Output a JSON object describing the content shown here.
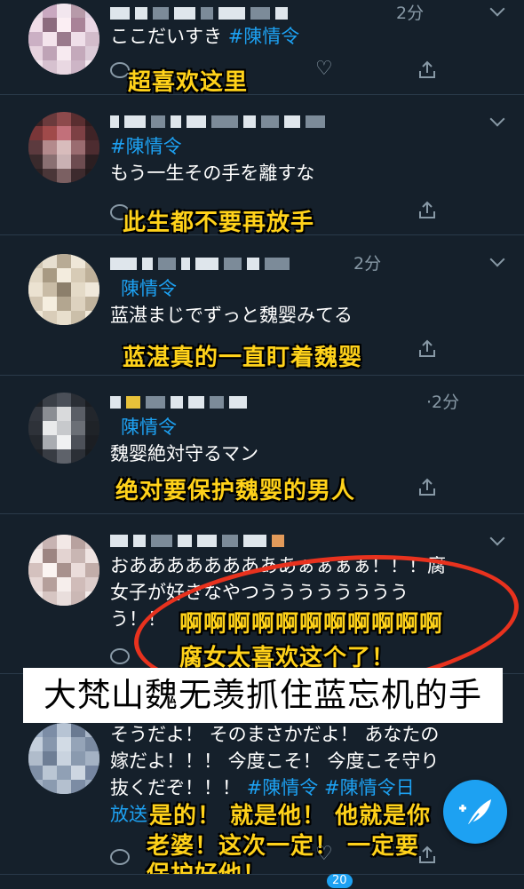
{
  "tweets": [
    {
      "time": "2分",
      "text_parts": [
        "ここだいすき ",
        "#陳情令"
      ],
      "caption": "超喜欢这里"
    },
    {
      "time": "",
      "hashtag": "#陳情令",
      "text": "もう一生その手を離すな",
      "caption": "此生都不要再放手"
    },
    {
      "time": "2分",
      "hashtag": "陳情令",
      "text": "蓝湛まじでずっと魏婴みてる",
      "caption": "蓝湛真的一直盯着魏婴"
    },
    {
      "time": "·2分",
      "hashtag": "陳情令",
      "text": "魏婴絶対守るマン",
      "caption": "绝对要保护魏婴的男人"
    },
    {
      "time": "",
      "lines": [
        "おあああああああああぁぁぁぁ！！！腐",
        "女子が好きなやつうううううううう",
        "う！！"
      ],
      "caption1": "啊啊啊啊啊啊啊啊啊啊啊",
      "caption2": "腐女太喜欢这个了！"
    },
    {
      "lines": [
        "そうだよ！ そのまさかだよ！ あなたの",
        "嫁だよ！！！ 今度こそ！ 今度こそ守り",
        "抜くだぞ！！！ "
      ],
      "hashtags": [
        "#陳情令",
        "#陳情令日"
      ],
      "line4": "放送",
      "caption_lines": [
        "是的！ 就是他！ 他就是你",
        "老婆！这次一定！ 一定要",
        "保护好他！"
      ]
    }
  ],
  "banner": "大梵山魏无羡抓住蓝忘机的手",
  "nav_badge": "20",
  "colors": {
    "background": "#15202b",
    "accent": "#1da1f2",
    "caption": "#ffd21a",
    "circle": "#e8321e"
  },
  "icons": [
    "reply-icon",
    "heart-icon",
    "share-icon",
    "compose-tweet-icon",
    "chevron-down-icon"
  ]
}
